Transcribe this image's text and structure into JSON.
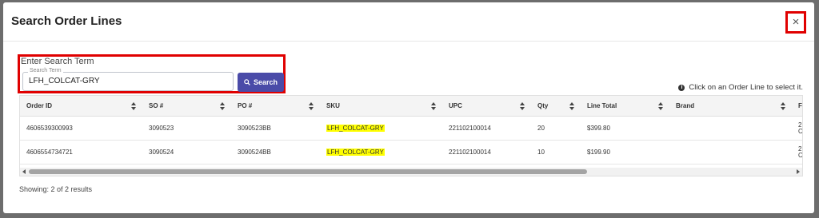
{
  "modal": {
    "title": "Search Order Lines",
    "close_glyph": "×"
  },
  "search": {
    "label": "Enter Search Term",
    "field_legend": "Search Term",
    "value": "LFH_COLCAT-GRY",
    "button_label": "Search",
    "button_icon": "search-icon"
  },
  "hint": {
    "icon": "info-icon",
    "text": "Click on an Order Line to select it."
  },
  "table": {
    "columns": [
      "Order ID",
      "SO #",
      "PO #",
      "SKU",
      "UPC",
      "Qty",
      "Line Total",
      "Brand",
      "F"
    ],
    "rows": [
      {
        "order_id": "4606539300993",
        "so": "3090523",
        "po": "3090523BB",
        "sku": "LFH_COLCAT-GRY",
        "upc": "221102100014",
        "qty": "20",
        "line_total": "$399.80",
        "brand": "",
        "cut": "2\nC"
      },
      {
        "order_id": "4606554734721",
        "so": "3090524",
        "po": "3090524BB",
        "sku": "LFH_COLCAT-GRY",
        "upc": "221102100014",
        "qty": "10",
        "line_total": "$199.90",
        "brand": "",
        "cut": "2\nC"
      }
    ]
  },
  "footer": {
    "status": "Showing: 2 of 2 results"
  },
  "colors": {
    "highlight": "#ffff00",
    "primary_button": "#4a4ba8",
    "annotation_box": "#e00000"
  }
}
